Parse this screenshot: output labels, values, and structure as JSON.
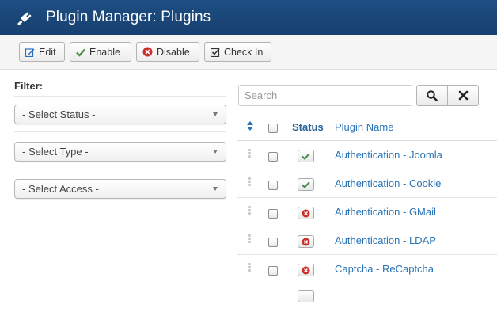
{
  "header": {
    "title": "Plugin Manager: Plugins",
    "icon": "plug-icon"
  },
  "toolbar": {
    "edit_label": "Edit",
    "enable_label": "Enable",
    "disable_label": "Disable",
    "checkin_label": "Check In"
  },
  "filter": {
    "title": "Filter:",
    "status_value": "- Select Status -",
    "type_value": "- Select Type -",
    "access_value": "- Select Access -"
  },
  "search": {
    "placeholder": "Search"
  },
  "table": {
    "columns": {
      "status": "Status",
      "name": "Plugin Name"
    },
    "rows": [
      {
        "name": "Authentication - Joomla",
        "status": "enabled"
      },
      {
        "name": "Authentication - Cookie",
        "status": "enabled"
      },
      {
        "name": "Authentication - GMail",
        "status": "disabled"
      },
      {
        "name": "Authentication - LDAP",
        "status": "disabled"
      },
      {
        "name": "Captcha - ReCaptcha",
        "status": "disabled"
      }
    ]
  },
  "colors": {
    "header": "#1b4778",
    "link": "#2a73b5",
    "enabled": "#468847",
    "disabled": "#c9302c"
  }
}
